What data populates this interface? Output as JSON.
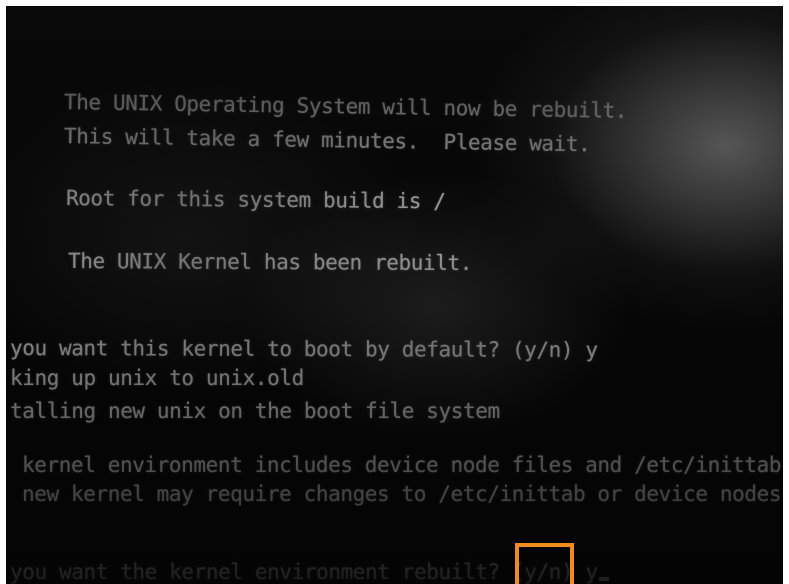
{
  "terminal": {
    "lines": {
      "rebuild_notice": "The UNIX Operating System will now be rebuilt.",
      "wait_notice": "This will take a few minutes.  Please wait.",
      "root_notice": "Root for this system build is /",
      "kernel_rebuilt": "The UNIX Kernel has been rebuilt.",
      "boot_default_prompt": "you want this kernel to boot by default? (y/n) y",
      "backing_up": "king up unix to unix.old",
      "installing": "talling new unix on the boot file system",
      "env_includes": "kernel environment includes device node files and /etc/inittab.",
      "env_changes": "new kernel may require changes to /etc/inittab or device nodes.",
      "env_rebuild_prompt": "you want the kernel environment rebuilt? (y/n) y"
    },
    "highlight_color": "#f08c1c"
  }
}
